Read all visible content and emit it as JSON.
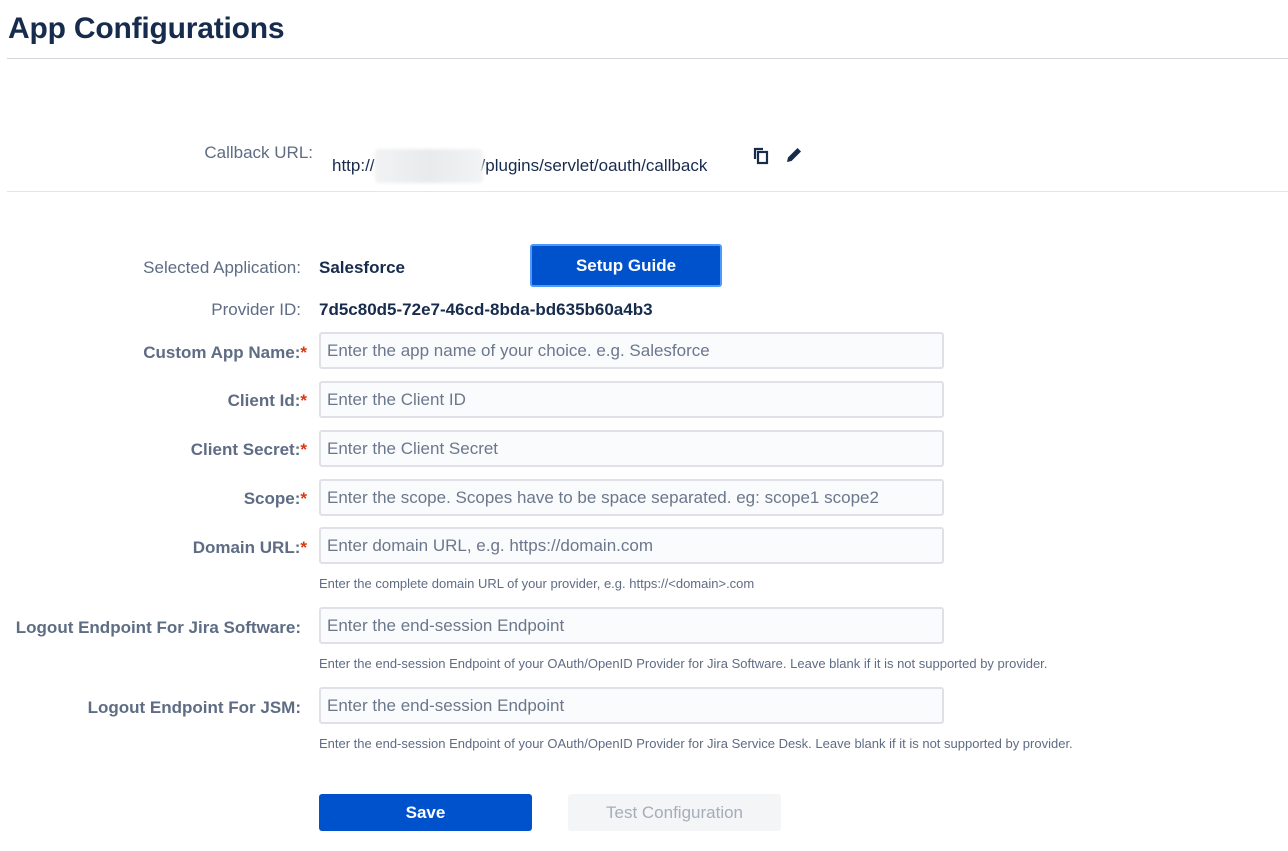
{
  "page": {
    "title": "App Configurations"
  },
  "callback": {
    "label": "Callback URL:",
    "url_prefix": "http://",
    "url_suffix": "/plugins/servlet/oauth/callback",
    "copy_icon": "copy-icon",
    "edit_icon": "pencil-icon"
  },
  "app": {
    "selected_label": "Selected Application:",
    "selected_value": "Salesforce",
    "setup_guide": "Setup Guide",
    "provider_label": "Provider ID:",
    "provider_value": "7d5c80d5-72e7-46cd-8bda-bd635b60a4b3"
  },
  "form": {
    "custom_app_name": {
      "label": "Custom App Name:",
      "required": "*",
      "placeholder": "Enter the app name of your choice. e.g. Salesforce",
      "value": ""
    },
    "client_id": {
      "label": "Client Id:",
      "required": "*",
      "placeholder": "Enter the Client ID",
      "value": ""
    },
    "client_secret": {
      "label": "Client Secret:",
      "required": "*",
      "placeholder": "Enter the Client Secret",
      "value": ""
    },
    "scope": {
      "label": "Scope:",
      "required": "*",
      "placeholder": "Enter the scope. Scopes have to be space separated. eg: scope1 scope2",
      "value": ""
    },
    "domain_url": {
      "label": "Domain URL:",
      "required": "*",
      "placeholder": "Enter domain URL, e.g. https://domain.com",
      "value": "",
      "help": "Enter the complete domain URL of your provider, e.g. https://<domain>.com"
    },
    "logout_jira": {
      "label": "Logout Endpoint For Jira Software:",
      "placeholder": "Enter the end-session Endpoint",
      "value": "",
      "help": "Enter the end-session Endpoint of your OAuth/OpenID Provider for Jira Software. Leave blank if it is not supported by provider."
    },
    "logout_jsm": {
      "label": "Logout Endpoint For JSM:",
      "placeholder": "Enter the end-session Endpoint",
      "value": "",
      "help": "Enter the end-session Endpoint of your OAuth/OpenID Provider for Jira Service Desk. Leave blank if it is not supported by provider."
    }
  },
  "actions": {
    "save": "Save",
    "test": "Test Configuration"
  },
  "colors": {
    "primary": "#0052cc",
    "label": "#5e6c84",
    "heading": "#172b4d",
    "required": "#de350b",
    "disabled_bg": "#f4f5f7",
    "disabled_text": "#a5adba"
  }
}
